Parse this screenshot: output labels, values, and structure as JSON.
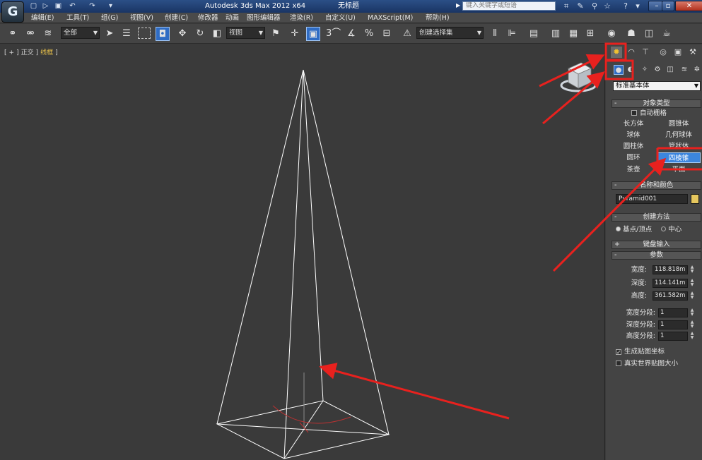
{
  "titlebar": {
    "app_title": "Autodesk 3ds Max  2012 x64",
    "document": "无标题",
    "search_placeholder": "键入关键字或短语",
    "quick_access": [
      "new-file-icon",
      "open-file-icon",
      "save-file-icon",
      "undo-icon",
      "redo-icon"
    ]
  },
  "menubar": {
    "items": [
      "编辑(E)",
      "工具(T)",
      "组(G)",
      "视图(V)",
      "创建(C)",
      "修改器",
      "动画",
      "图形编辑器",
      "渲染(R)",
      "自定义(U)",
      "MAXScript(M)",
      "帮助(H)"
    ]
  },
  "toolbar": {
    "selection_filter": "全部",
    "reference_coord": "视图",
    "named_selection": "创建选择集",
    "snap_labels": [
      "3",
      "%"
    ]
  },
  "viewport": {
    "label": [
      "[",
      "+",
      "]",
      "正交",
      "]",
      "线框",
      "]"
    ],
    "label_text": "[ + ] 正交 ] 线框 ]",
    "view_name": "正交",
    "shading": "线框",
    "object": "Pyramid001"
  },
  "panel": {
    "category": "标准基本体",
    "object_type": {
      "header": "对象类型",
      "autogrid": "自动栅格",
      "buttons": [
        "长方体",
        "圆锥体",
        "球体",
        "几何球体",
        "圆柱体",
        "管状体",
        "圆环",
        "四棱锥",
        "茶壶",
        "平面"
      ],
      "selected": "四棱锥"
    },
    "name_and_color": {
      "header": "名称和颜色",
      "name": "Pyramid001",
      "color": "#e6c75e"
    },
    "creation_method": {
      "header": "创建方法",
      "options": [
        "基点/顶点",
        "中心"
      ],
      "selected": "基点/顶点"
    },
    "keyboard_entry": {
      "header": "键盘输入"
    },
    "parameters": {
      "header": "参数",
      "width_label": "宽度:",
      "width": "118.818m",
      "depth_label": "深度:",
      "depth": "114.141m",
      "height_label": "高度:",
      "height": "361.582m",
      "width_segs_label": "宽度分段:",
      "width_segs": "1",
      "depth_segs_label": "深度分段:",
      "depth_segs": "1",
      "height_segs_label": "高度分段:",
      "height_segs": "1",
      "gen_mapping": "生成贴图坐标",
      "real_world": "真实世界贴图大小"
    }
  },
  "colors": {
    "annotation": "#e8211e",
    "selected_button": "#3c86de",
    "wireframe": "#ffffff",
    "viewport_bg": "#3a3a3a"
  }
}
